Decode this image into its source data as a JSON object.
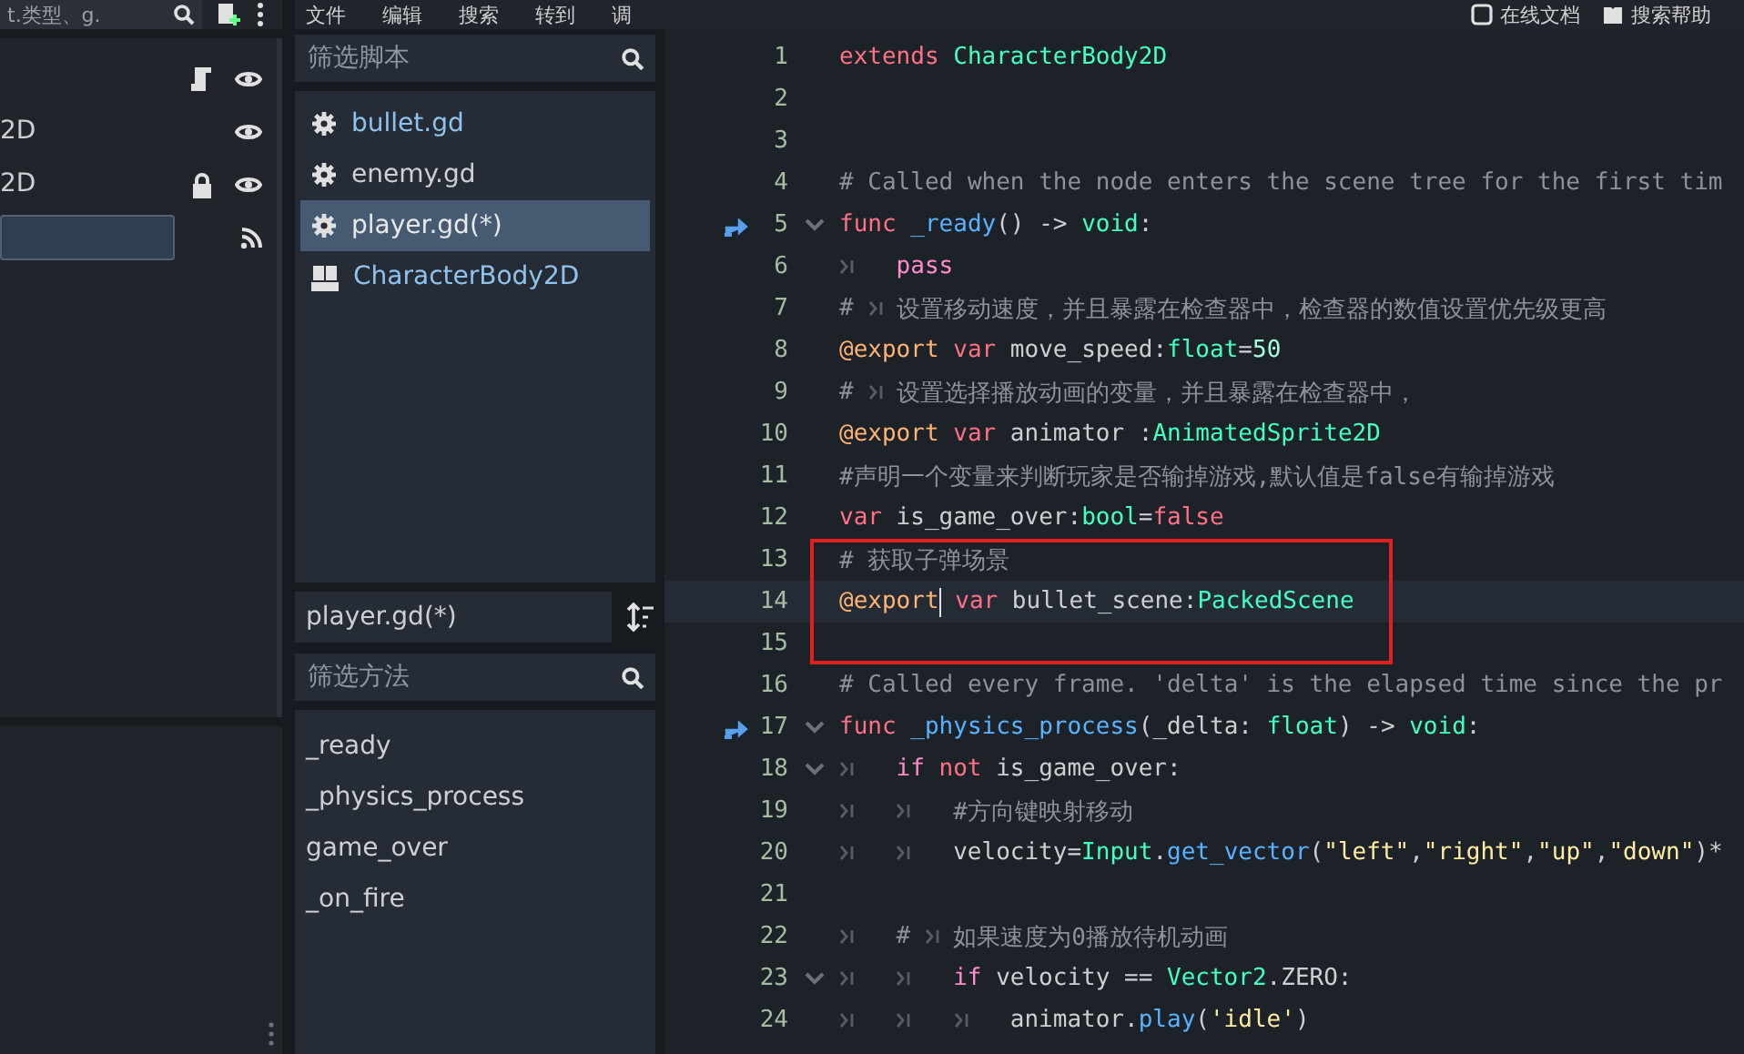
{
  "scene_dock": {
    "search": {
      "value": "t.类型、g."
    },
    "tree": [
      {
        "selected": false,
        "script": true,
        "visible": true,
        "locked": false,
        "signals": false
      },
      {
        "label": "2D",
        "selected": false,
        "script": false,
        "visible": true,
        "locked": false,
        "signals": false
      },
      {
        "label": "2D",
        "selected": false,
        "script": false,
        "visible": true,
        "locked": true,
        "signals": false
      },
      {
        "selected": true,
        "script": false,
        "visible": false,
        "locked": false,
        "signals": true
      }
    ]
  },
  "menu": [
    "文件",
    "编辑",
    "搜索",
    "转到",
    "调"
  ],
  "help_links": [
    {
      "kind": "docs",
      "label": "在线文档"
    },
    {
      "kind": "help",
      "label": "搜索帮助"
    }
  ],
  "scripts": {
    "filter": {
      "placeholder": "筛选脚本"
    },
    "items": [
      {
        "label": "bullet.gd",
        "kind": "script",
        "selected": false,
        "color": "#8fc3ee"
      },
      {
        "label": "enemy.gd",
        "kind": "script",
        "selected": false,
        "color": "#cdcfd2"
      },
      {
        "label": "player.gd(*)",
        "kind": "script",
        "selected": true,
        "color": "#e6e8ea"
      },
      {
        "label": "CharacterBody2D",
        "kind": "doc",
        "selected": false,
        "color": "#8fc3ee"
      }
    ]
  },
  "current_script": "player.gd(*)",
  "methods": {
    "filter": {
      "placeholder": "筛选方法"
    },
    "items": [
      "_ready",
      "_physics_process",
      "game_over",
      "_on_fire"
    ]
  },
  "code": [
    {
      "number": "1",
      "override": false,
      "fold": false,
      "current": false,
      "boxed": false,
      "tokens": [
        {
          "kind": "keyword",
          "text": "extends"
        },
        {
          "kind": "type",
          "text": " CharacterBody2D"
        }
      ]
    },
    {
      "number": "2",
      "override": false,
      "fold": false,
      "current": false,
      "boxed": false
    },
    {
      "number": "3",
      "override": false,
      "fold": false,
      "current": false,
      "boxed": false
    },
    {
      "number": "4",
      "override": false,
      "fold": false,
      "current": false,
      "boxed": false,
      "tokens": [
        {
          "kind": "comment",
          "text": "# Called when the node enters the scene tree for the first tim"
        }
      ]
    },
    {
      "number": "5",
      "override": true,
      "fold": true,
      "current": false,
      "boxed": false,
      "tokens": [
        {
          "kind": "keyword",
          "text": "func"
        },
        {
          "kind": "func",
          "text": " _ready"
        },
        {
          "kind": "plain",
          "text": "() -> "
        },
        {
          "kind": "type",
          "text": "void"
        },
        {
          "kind": "plain",
          "text": ":"
        }
      ]
    },
    {
      "number": "6",
      "override": false,
      "fold": false,
      "current": false,
      "boxed": false,
      "tokens": [
        {
          "kind": "tab"
        },
        {
          "kind": "control",
          "text": "pass"
        }
      ]
    },
    {
      "number": "7",
      "override": false,
      "fold": false,
      "current": false,
      "boxed": false,
      "tokens": [
        {
          "kind": "comment",
          "text": "# "
        },
        {
          "kind": "tab"
        },
        {
          "kind": "comment",
          "text": "设置移动速度，并且暴露在检查器中，检查器的数值设置优先级更高"
        }
      ]
    },
    {
      "number": "8",
      "override": false,
      "fold": false,
      "current": false,
      "boxed": false,
      "tokens": [
        {
          "kind": "annotation",
          "text": "@export"
        },
        {
          "kind": "keyword",
          "text": " var"
        },
        {
          "kind": "plain",
          "text": " move_speed:"
        },
        {
          "kind": "type",
          "text": "float"
        },
        {
          "kind": "plain",
          "text": "="
        },
        {
          "kind": "number",
          "text": "50"
        }
      ]
    },
    {
      "number": "9",
      "override": false,
      "fold": false,
      "current": false,
      "boxed": false,
      "tokens": [
        {
          "kind": "comment",
          "text": "# "
        },
        {
          "kind": "tab"
        },
        {
          "kind": "comment",
          "text": "设置选择播放动画的变量，并且暴露在检查器中，"
        }
      ]
    },
    {
      "number": "10",
      "override": false,
      "fold": false,
      "current": false,
      "boxed": false,
      "tokens": [
        {
          "kind": "annotation",
          "text": "@export"
        },
        {
          "kind": "keyword",
          "text": " var"
        },
        {
          "kind": "plain",
          "text": " animator :"
        },
        {
          "kind": "type",
          "text": "AnimatedSprite2D"
        }
      ]
    },
    {
      "number": "11",
      "override": false,
      "fold": false,
      "current": false,
      "boxed": false,
      "tokens": [
        {
          "kind": "comment",
          "text": "#声明一个变量来判断玩家是否输掉游戏,默认值是false有输掉游戏"
        }
      ]
    },
    {
      "number": "12",
      "override": false,
      "fold": false,
      "current": false,
      "boxed": false,
      "tokens": [
        {
          "kind": "keyword",
          "text": "var"
        },
        {
          "kind": "plain",
          "text": " is_game_over:"
        },
        {
          "kind": "type",
          "text": "bool"
        },
        {
          "kind": "plain",
          "text": "="
        },
        {
          "kind": "keyword",
          "text": "false"
        }
      ]
    },
    {
      "number": "13",
      "override": false,
      "fold": false,
      "current": false,
      "boxed": true,
      "tokens": [
        {
          "kind": "comment",
          "text": "# 获取子弹场景"
        }
      ]
    },
    {
      "number": "14",
      "override": false,
      "fold": false,
      "current": true,
      "boxed": true,
      "tokens": [
        {
          "kind": "annotation",
          "text": "@export"
        },
        {
          "kind": "caret"
        },
        {
          "kind": "keyword",
          "text": " var"
        },
        {
          "kind": "plain",
          "text": " bullet_scene:"
        },
        {
          "kind": "type",
          "text": "PackedScene"
        }
      ]
    },
    {
      "number": "15",
      "override": false,
      "fold": false,
      "current": false,
      "boxed": true
    },
    {
      "number": "16",
      "override": false,
      "fold": false,
      "current": false,
      "boxed": false,
      "tokens": [
        {
          "kind": "comment",
          "text": "# Called every frame. 'delta' is the elapsed time since the pr"
        }
      ]
    },
    {
      "number": "17",
      "override": true,
      "fold": true,
      "current": false,
      "boxed": false,
      "tokens": [
        {
          "kind": "keyword",
          "text": "func"
        },
        {
          "kind": "func",
          "text": " _physics_process"
        },
        {
          "kind": "plain",
          "text": "(_delta: "
        },
        {
          "kind": "type",
          "text": "float"
        },
        {
          "kind": "plain",
          "text": ") -> "
        },
        {
          "kind": "type",
          "text": "void"
        },
        {
          "kind": "plain",
          "text": ":"
        }
      ]
    },
    {
      "number": "18",
      "override": false,
      "fold": true,
      "current": false,
      "boxed": false,
      "tokens": [
        {
          "kind": "tab"
        },
        {
          "kind": "control",
          "text": "if"
        },
        {
          "kind": "keyword",
          "text": " not"
        },
        {
          "kind": "plain",
          "text": " is_game_over:"
        }
      ]
    },
    {
      "number": "19",
      "override": false,
      "fold": false,
      "current": false,
      "boxed": false,
      "tokens": [
        {
          "kind": "tab"
        },
        {
          "kind": "tab"
        },
        {
          "kind": "comment",
          "text": "#方向键映射移动"
        }
      ]
    },
    {
      "number": "20",
      "override": false,
      "fold": false,
      "current": false,
      "boxed": false,
      "tokens": [
        {
          "kind": "tab"
        },
        {
          "kind": "tab"
        },
        {
          "kind": "plain",
          "text": "velocity="
        },
        {
          "kind": "type",
          "text": "Input"
        },
        {
          "kind": "plain",
          "text": "."
        },
        {
          "kind": "func",
          "text": "get_vector"
        },
        {
          "kind": "plain",
          "text": "("
        },
        {
          "kind": "string",
          "text": "\"left\""
        },
        {
          "kind": "plain",
          "text": ","
        },
        {
          "kind": "string",
          "text": "\"right\""
        },
        {
          "kind": "plain",
          "text": ","
        },
        {
          "kind": "string",
          "text": "\"up\""
        },
        {
          "kind": "plain",
          "text": ","
        },
        {
          "kind": "string",
          "text": "\"down\""
        },
        {
          "kind": "plain",
          "text": ")*"
        }
      ]
    },
    {
      "number": "21",
      "override": false,
      "fold": false,
      "current": false,
      "boxed": false
    },
    {
      "number": "22",
      "override": false,
      "fold": false,
      "current": false,
      "boxed": false,
      "tokens": [
        {
          "kind": "tab"
        },
        {
          "kind": "comment",
          "text": "# "
        },
        {
          "kind": "tab"
        },
        {
          "kind": "comment",
          "text": "如果速度为0播放待机动画"
        }
      ]
    },
    {
      "number": "23",
      "override": false,
      "fold": true,
      "current": false,
      "boxed": false,
      "tokens": [
        {
          "kind": "tab"
        },
        {
          "kind": "tab"
        },
        {
          "kind": "control",
          "text": "if"
        },
        {
          "kind": "plain",
          "text": " velocity == "
        },
        {
          "kind": "type",
          "text": "Vector2"
        },
        {
          "kind": "plain",
          "text": ".ZERO:"
        }
      ]
    },
    {
      "number": "24",
      "override": false,
      "fold": false,
      "current": false,
      "boxed": false,
      "tokens": [
        {
          "kind": "tab"
        },
        {
          "kind": "tab"
        },
        {
          "kind": "tab"
        },
        {
          "kind": "plain",
          "text": "animator."
        },
        {
          "kind": "func",
          "text": "play"
        },
        {
          "kind": "plain",
          "text": "("
        },
        {
          "kind": "string",
          "text": "'idle'"
        },
        {
          "kind": "plain",
          "text": ")"
        }
      ]
    }
  ]
}
